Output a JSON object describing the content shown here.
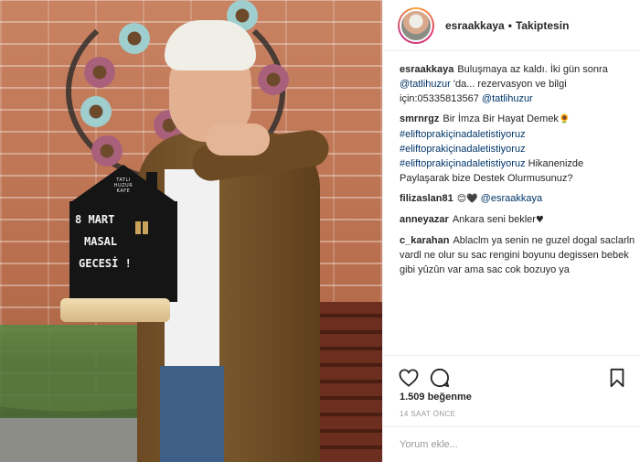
{
  "header": {
    "username": "esraakkaya",
    "separator": "•",
    "follow_status": "Takiptesin"
  },
  "sign": {
    "brand_top": "TATLI",
    "brand_mid": "HUZUR",
    "brand_bottom": "KAFE",
    "line1": "8 MART",
    "line2": "MASAL",
    "line3": "GECESİ !"
  },
  "comments": [
    {
      "user": "esraakkaya",
      "text_parts": [
        {
          "kind": "text",
          "value": "Buluşmaya az kaldı. İki gün sonra "
        },
        {
          "kind": "mention",
          "value": "@tatlihuzur"
        },
        {
          "kind": "text",
          "value": " 'da... rezervasyon ve bilgi için:05335813567 "
        },
        {
          "kind": "mention",
          "value": "@tatlihuzur"
        }
      ]
    },
    {
      "user": "smrnrgz",
      "text_parts": [
        {
          "kind": "text",
          "value": "Bir İmza Bir Hayat Demek"
        },
        {
          "kind": "emoji",
          "value": "🌻"
        },
        {
          "kind": "break",
          "value": ""
        },
        {
          "kind": "hashtag",
          "value": "#eliftoprakiçinadaletistiyoruz"
        },
        {
          "kind": "break",
          "value": ""
        },
        {
          "kind": "hashtag",
          "value": "#eliftoprakiçinadaletistiyoruz"
        },
        {
          "kind": "break",
          "value": ""
        },
        {
          "kind": "hashtag",
          "value": "#eliftoprakiçinadaletistiyoruz"
        },
        {
          "kind": "text",
          "value": " Hikanenizde Paylaşarak bize Destek Olurmusunuz?"
        }
      ]
    },
    {
      "user": "filizaslan81",
      "text_parts": [
        {
          "kind": "emoji",
          "value": "😊"
        },
        {
          "kind": "emoji",
          "value": "🖤"
        },
        {
          "kind": "text",
          "value": " "
        },
        {
          "kind": "mention",
          "value": "@esraakkaya"
        }
      ]
    },
    {
      "user": "anneyazar",
      "text_parts": [
        {
          "kind": "text",
          "value": "Ankara seni bekler"
        },
        {
          "kind": "emoji",
          "value": "♥"
        }
      ]
    },
    {
      "user": "c_karahan",
      "text_parts": [
        {
          "kind": "text",
          "value": "Ablaclm ya senin ne guzel dogal saclarln vardl ne olur su sac rengini boyunu degissen bebek gibi yûzûn var ama sac cok bozuyo ya"
        }
      ]
    }
  ],
  "actions": {
    "like_icon": "heart-outline-icon",
    "comment_icon": "comment-bubble-icon",
    "save_icon": "bookmark-icon"
  },
  "likes_label": "1.509 beğenme",
  "timestamp": "14 SAAT ÖNCE",
  "comment_input": {
    "placeholder": "Yorum ekle..."
  }
}
